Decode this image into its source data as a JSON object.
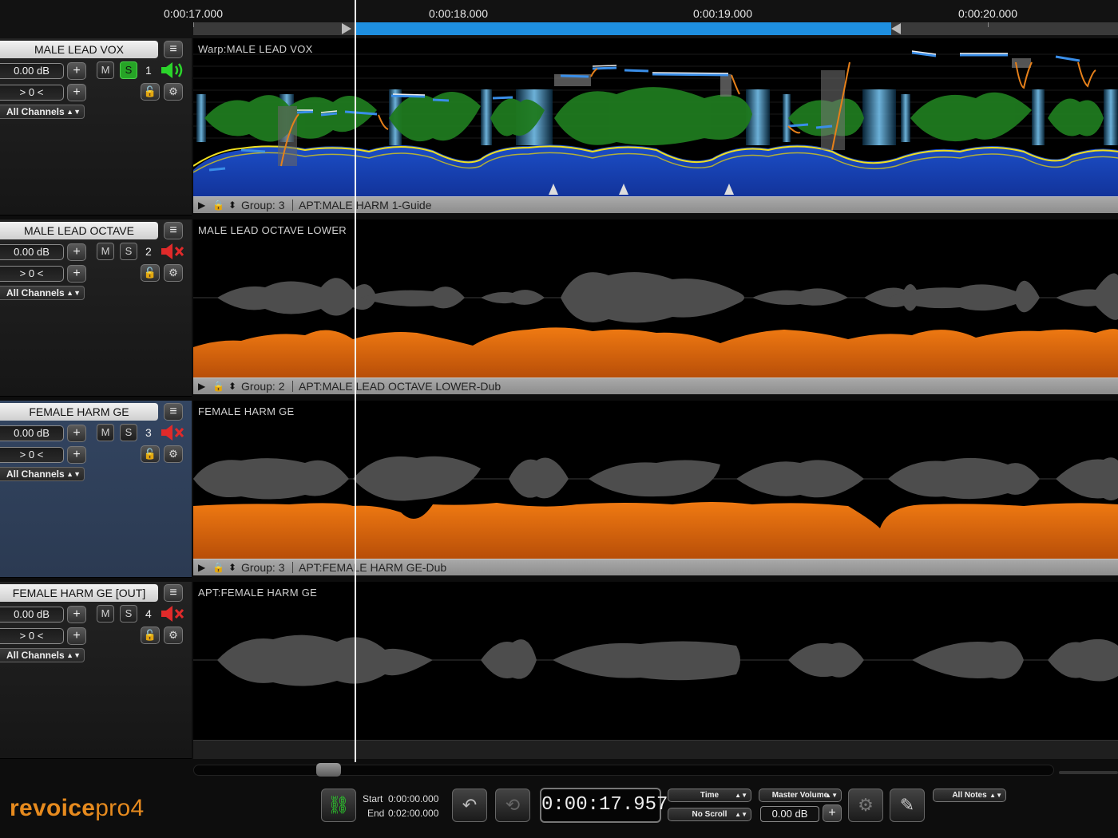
{
  "ruler": {
    "ticks": [
      "0:00:17.000",
      "0:00:18.000",
      "0:00:19.000",
      "0:00:20.000"
    ]
  },
  "tracks": [
    {
      "name": "MALE LEAD VOX",
      "volume": "0.00 dB",
      "pan": "> 0 <",
      "mute_label": "M",
      "solo_label": "S",
      "solo_active": true,
      "number": "1",
      "speaker_state": "on",
      "channels": "All Channels",
      "lane_label": "Warp:MALE LEAD VOX",
      "group_text": "Group: 3",
      "apt_text": "APT:MALE HARM 1-Guide"
    },
    {
      "name": "MALE LEAD OCTAVE",
      "volume": "0.00 dB",
      "pan": "> 0 <",
      "mute_label": "M",
      "solo_label": "S",
      "solo_active": false,
      "number": "2",
      "speaker_state": "muted",
      "channels": "All Channels",
      "lane_label": "MALE LEAD OCTAVE LOWER",
      "group_text": "Group: 2",
      "apt_text": "APT:MALE LEAD OCTAVE LOWER-Dub"
    },
    {
      "name": "FEMALE HARM GE",
      "volume": "0.00 dB",
      "pan": "> 0 <",
      "mute_label": "M",
      "solo_label": "S",
      "solo_active": false,
      "number": "3",
      "speaker_state": "muted",
      "channels": "All Channels",
      "lane_label": "FEMALE HARM GE",
      "group_text": "Group: 3",
      "apt_text": "APT:FEMALE HARM GE-Dub"
    },
    {
      "name": "FEMALE HARM GE [OUT]",
      "volume": "0.00 dB",
      "pan": "> 0 <",
      "mute_label": "M",
      "solo_label": "S",
      "solo_active": false,
      "number": "4",
      "speaker_state": "muted",
      "channels": "All Channels",
      "lane_label": "APT:FEMALE HARM GE"
    }
  ],
  "transport": {
    "logo_bold": "revoice",
    "logo_light": "pro4",
    "start_label": "Start",
    "start_value": "0:00:00.000",
    "end_label": "End",
    "end_value": "0:02:00.000",
    "current_time": "0:00:17.957",
    "time_mode": "Time",
    "scroll_mode": "No Scroll",
    "master_volume_label": "Master Volume",
    "master_volume_value": "0.00 dB",
    "notes_mode": "All Notes"
  },
  "colors": {
    "accent_blue": "#1e8fe0",
    "solo_green": "#26a426",
    "waveform_orange": "#e6700f",
    "waveform_grey": "#555555",
    "waveform_green": "#1f7a1f",
    "pitch_yellow": "#f0e020",
    "brand_orange": "#e68a1e"
  },
  "icons": {
    "link": "link-icon",
    "undo": "undo-icon",
    "loop": "loop-icon",
    "settings": "gear-icon",
    "tool": "brush-icon"
  }
}
